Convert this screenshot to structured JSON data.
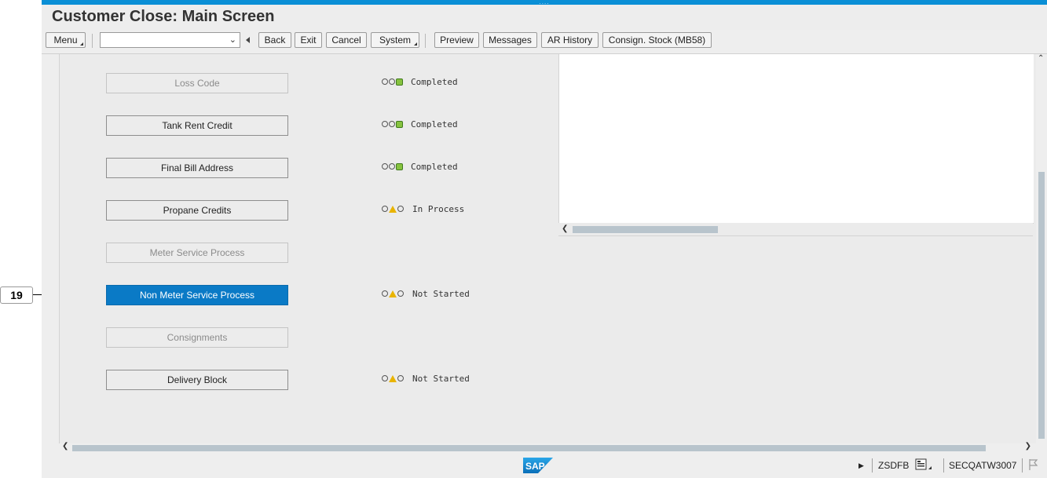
{
  "window": {
    "title": "Customer Close: Main Screen"
  },
  "toolbar": {
    "menu": "Menu",
    "back": "Back",
    "exit": "Exit",
    "cancel": "Cancel",
    "system": "System",
    "preview": "Preview",
    "messages": "Messages",
    "ar_history": "AR History",
    "consign_stock": "Consign. Stock (MB58)",
    "command_field_value": ""
  },
  "steps": [
    {
      "label": "Loss Code",
      "state": "disabled",
      "status": "Completed",
      "light": "green"
    },
    {
      "label": "Tank Rent Credit",
      "state": "enabled",
      "status": "Completed",
      "light": "green"
    },
    {
      "label": "Final Bill Address",
      "state": "enabled",
      "status": "Completed",
      "light": "green"
    },
    {
      "label": "Propane Credits",
      "state": "enabled",
      "status": "In Process",
      "light": "yellow"
    },
    {
      "label": "Meter Service Process",
      "state": "disabled",
      "status": "",
      "light": ""
    },
    {
      "label": "Non Meter Service Process",
      "state": "active",
      "status": "Not Started",
      "light": "yellow"
    },
    {
      "label": "Consignments",
      "state": "disabled",
      "status": "",
      "light": ""
    },
    {
      "label": "Delivery Block",
      "state": "enabled",
      "status": "Not Started",
      "light": "yellow"
    }
  ],
  "status_bar": {
    "transaction": "ZSDFB",
    "server": "SECQATW3007"
  },
  "callout": {
    "number": "19"
  },
  "colors": {
    "accent": "#0a7ac6",
    "green_light": "#86c23f",
    "yellow_light": "#e9b400"
  }
}
